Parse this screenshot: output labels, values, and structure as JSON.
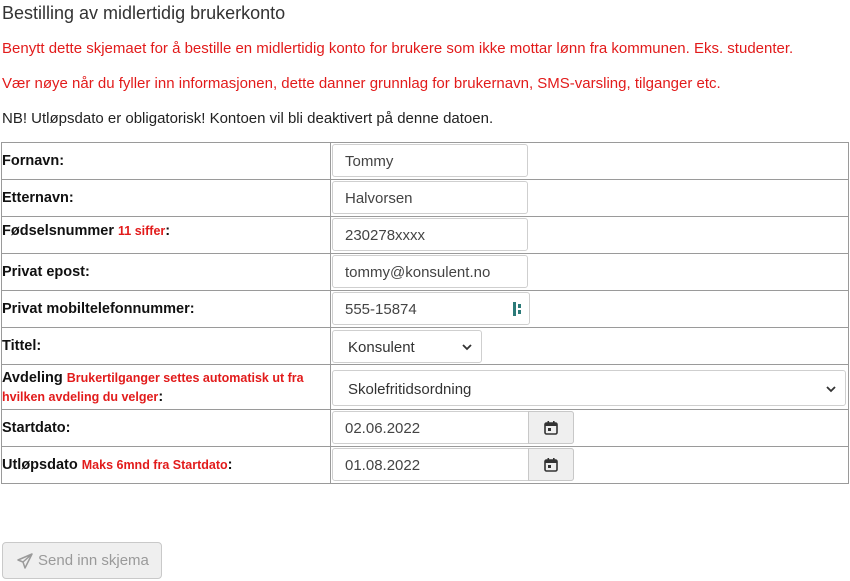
{
  "page": {
    "title": "Bestilling av midlertidig brukerkonto",
    "info1": "Benytt dette skjemaet for å bestille en midlertidig konto for brukere som ikke mottar lønn fra kommunen. Eks. studenter.",
    "info2": "Vær nøye når du fyller inn informasjonen, dette danner grunnlag for brukernavn, SMS-varsling, tilganger etc.",
    "info3": "NB! Utløpsdato er obligatorisk! Kontoen vil bli deaktivert på denne datoen."
  },
  "form": {
    "fornavn": {
      "label": "Fornavn:",
      "value": "Tommy"
    },
    "etternavn": {
      "label": "Etternavn:",
      "value": "Halvorsen"
    },
    "fodselsnummer": {
      "label": "Fødselsnummer",
      "hint": "11 siffer",
      "colon": ":",
      "value": "230278xxxx"
    },
    "epost": {
      "label": "Privat epost:",
      "value": "tommy@konsulent.no"
    },
    "mobil": {
      "label": "Privat mobiltelefonnummer:",
      "value": "555-15874"
    },
    "tittel": {
      "label": "Tittel:",
      "selected": "Konsulent"
    },
    "avdeling": {
      "label": "Avdeling",
      "hint": "Brukertilganger settes automatisk ut fra hvilken avdeling du velger",
      "colon": ":",
      "selected": "Skolefritidsordning"
    },
    "startdato": {
      "label": "Startdato:",
      "value": "02.06.2022"
    },
    "utlopsdato": {
      "label": "Utløpsdato",
      "hint": "Maks 6mnd fra Startdato",
      "colon": ":",
      "value": "01.08.2022"
    }
  },
  "submit": {
    "label": "Send inn skjema",
    "icon": "paper-plane-icon"
  },
  "colors": {
    "warning": "#e21b1b",
    "text": "#333333",
    "border": "#9a9a9a",
    "disabled": "#9a9a9a"
  }
}
